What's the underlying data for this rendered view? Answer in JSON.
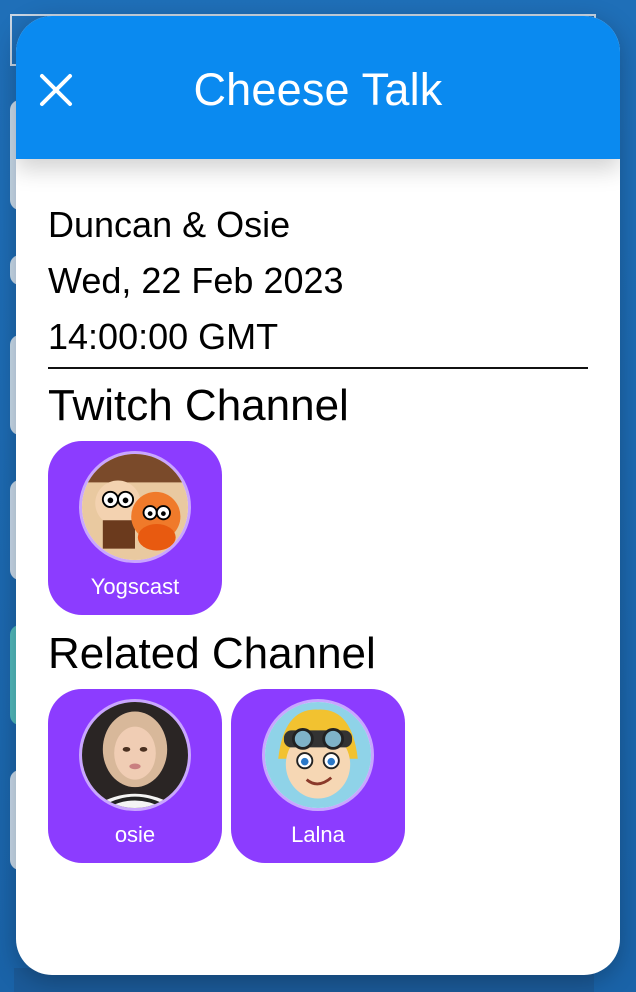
{
  "modal": {
    "title": "Cheese Talk",
    "close_icon": "close-icon"
  },
  "event": {
    "hosts": "Duncan & Osie",
    "date": "Wed, 22 Feb 2023",
    "time": "14:00:00 GMT"
  },
  "twitch_section": {
    "heading": "Twitch Channel",
    "channels": [
      {
        "name": "Yogscast",
        "icon": "yogscast-avatar"
      }
    ]
  },
  "related_section": {
    "heading": "Related Channel",
    "channels": [
      {
        "name": "osie",
        "icon": "osie-avatar"
      },
      {
        "name": "Lalna",
        "icon": "lalna-avatar"
      }
    ]
  },
  "colors": {
    "header": "#0a8af0",
    "channel_tile": "#8c3cff",
    "avatar_ring": "#c9a6ff"
  }
}
